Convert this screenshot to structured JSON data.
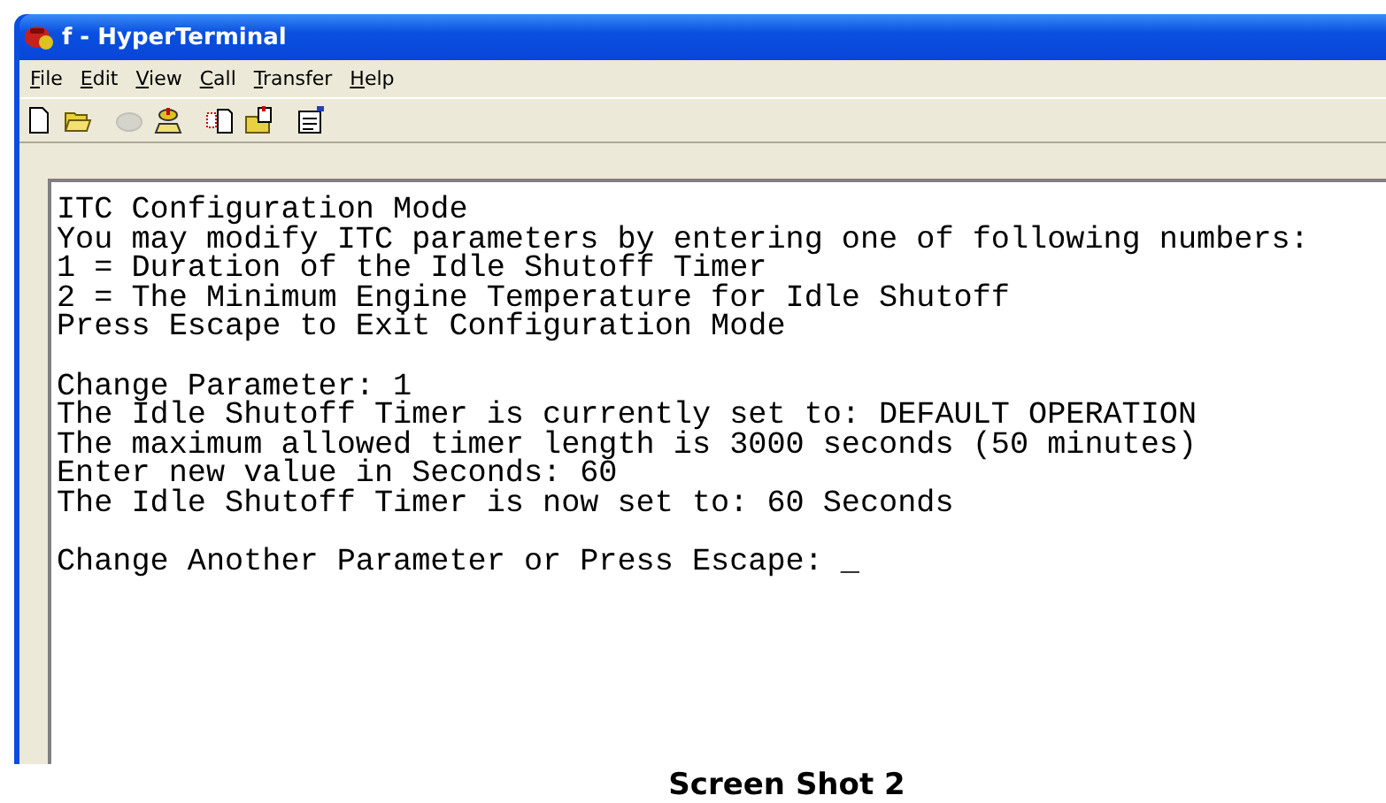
{
  "window": {
    "title": "f - HyperTerminal"
  },
  "menu": [
    "File",
    "Edit",
    "View",
    "Call",
    "Transfer",
    "Help"
  ],
  "toolbar": [
    {
      "kind": "new",
      "disabled": false
    },
    {
      "kind": "open",
      "disabled": false
    },
    {
      "kind": "call",
      "disabled": true
    },
    {
      "kind": "hangup",
      "disabled": false
    },
    {
      "kind": "send",
      "disabled": false
    },
    {
      "kind": "receive",
      "disabled": false
    },
    {
      "kind": "properties",
      "disabled": false
    }
  ],
  "terminal": {
    "blocks": [
      [
        "ITC Configuration Mode",
        "You may modify ITC parameters by entering one of following numbers:",
        "1 = Duration of the Idle Shutoff Timer",
        "2 = The Minimum Engine Temperature for Idle Shutoff",
        "Press Escape to Exit Configuration Mode"
      ],
      [
        "Change Parameter: 1",
        "The Idle Shutoff Timer is currently set to: DEFAULT OPERATION",
        "The maximum allowed timer length is 3000 seconds (50 minutes)",
        "Enter new value in Seconds: 60",
        "The Idle Shutoff Timer is now set to: 60 Seconds"
      ],
      [
        "Change Another Parameter or Press Escape:"
      ]
    ],
    "cursor": "_"
  },
  "caption": "Screen Shot 2"
}
